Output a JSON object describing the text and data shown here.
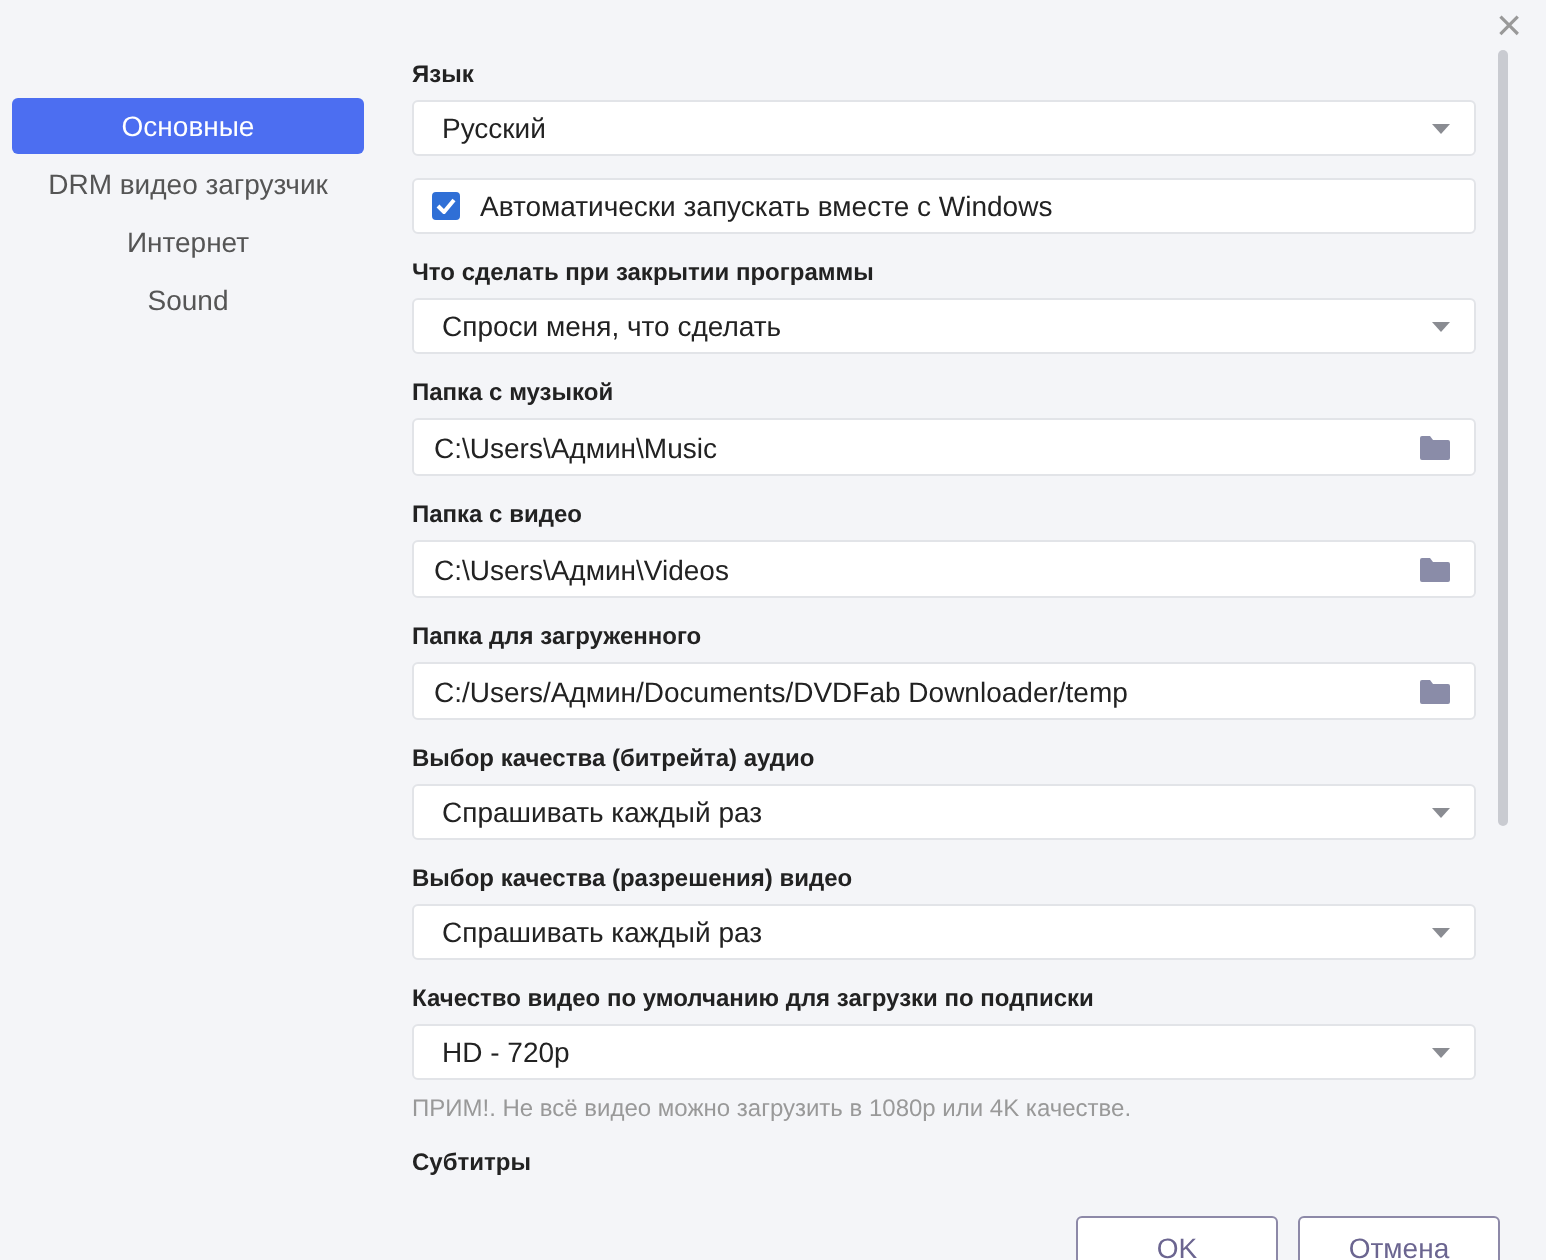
{
  "close_button": "×",
  "sidebar": {
    "items": [
      {
        "label": "Основные",
        "selected": true
      },
      {
        "label": "DRM видео загрузчик",
        "selected": false
      },
      {
        "label": "Интернет",
        "selected": false
      },
      {
        "label": "Sound",
        "selected": false
      }
    ]
  },
  "settings": [
    {
      "kind": "select",
      "label": "Язык",
      "value": "Русский"
    },
    {
      "kind": "checkbox",
      "text": "Автоматически запускать вместе с Windows",
      "checked": true
    },
    {
      "kind": "select",
      "label": "Что сделать при закрытии программы",
      "value": "Спроси меня, что сделать"
    },
    {
      "kind": "folder",
      "label": "Папка с музыкой",
      "value": "C:\\Users\\Админ\\Music"
    },
    {
      "kind": "folder",
      "label": "Папка с видео",
      "value": "C:\\Users\\Админ\\Videos"
    },
    {
      "kind": "folder",
      "label": "Папка для загруженного",
      "value": "C:/Users/Админ/Documents/DVDFab Downloader/temp"
    },
    {
      "kind": "select",
      "label": "Выбор качества (битрейта) аудио",
      "value": "Спрашивать каждый раз"
    },
    {
      "kind": "select",
      "label": "Выбор качества (разрешения) видео",
      "value": "Спрашивать каждый раз"
    },
    {
      "kind": "select",
      "label": "Качество видео по умолчанию для загрузки по подписки",
      "value": "HD - 720p",
      "note": "ПРИМ!. Не всё видео можно загрузить в 1080p или 4K качестве."
    },
    {
      "kind": "heading",
      "label": "Субтитры"
    }
  ],
  "buttons": [
    "OK",
    "Отмена"
  ]
}
